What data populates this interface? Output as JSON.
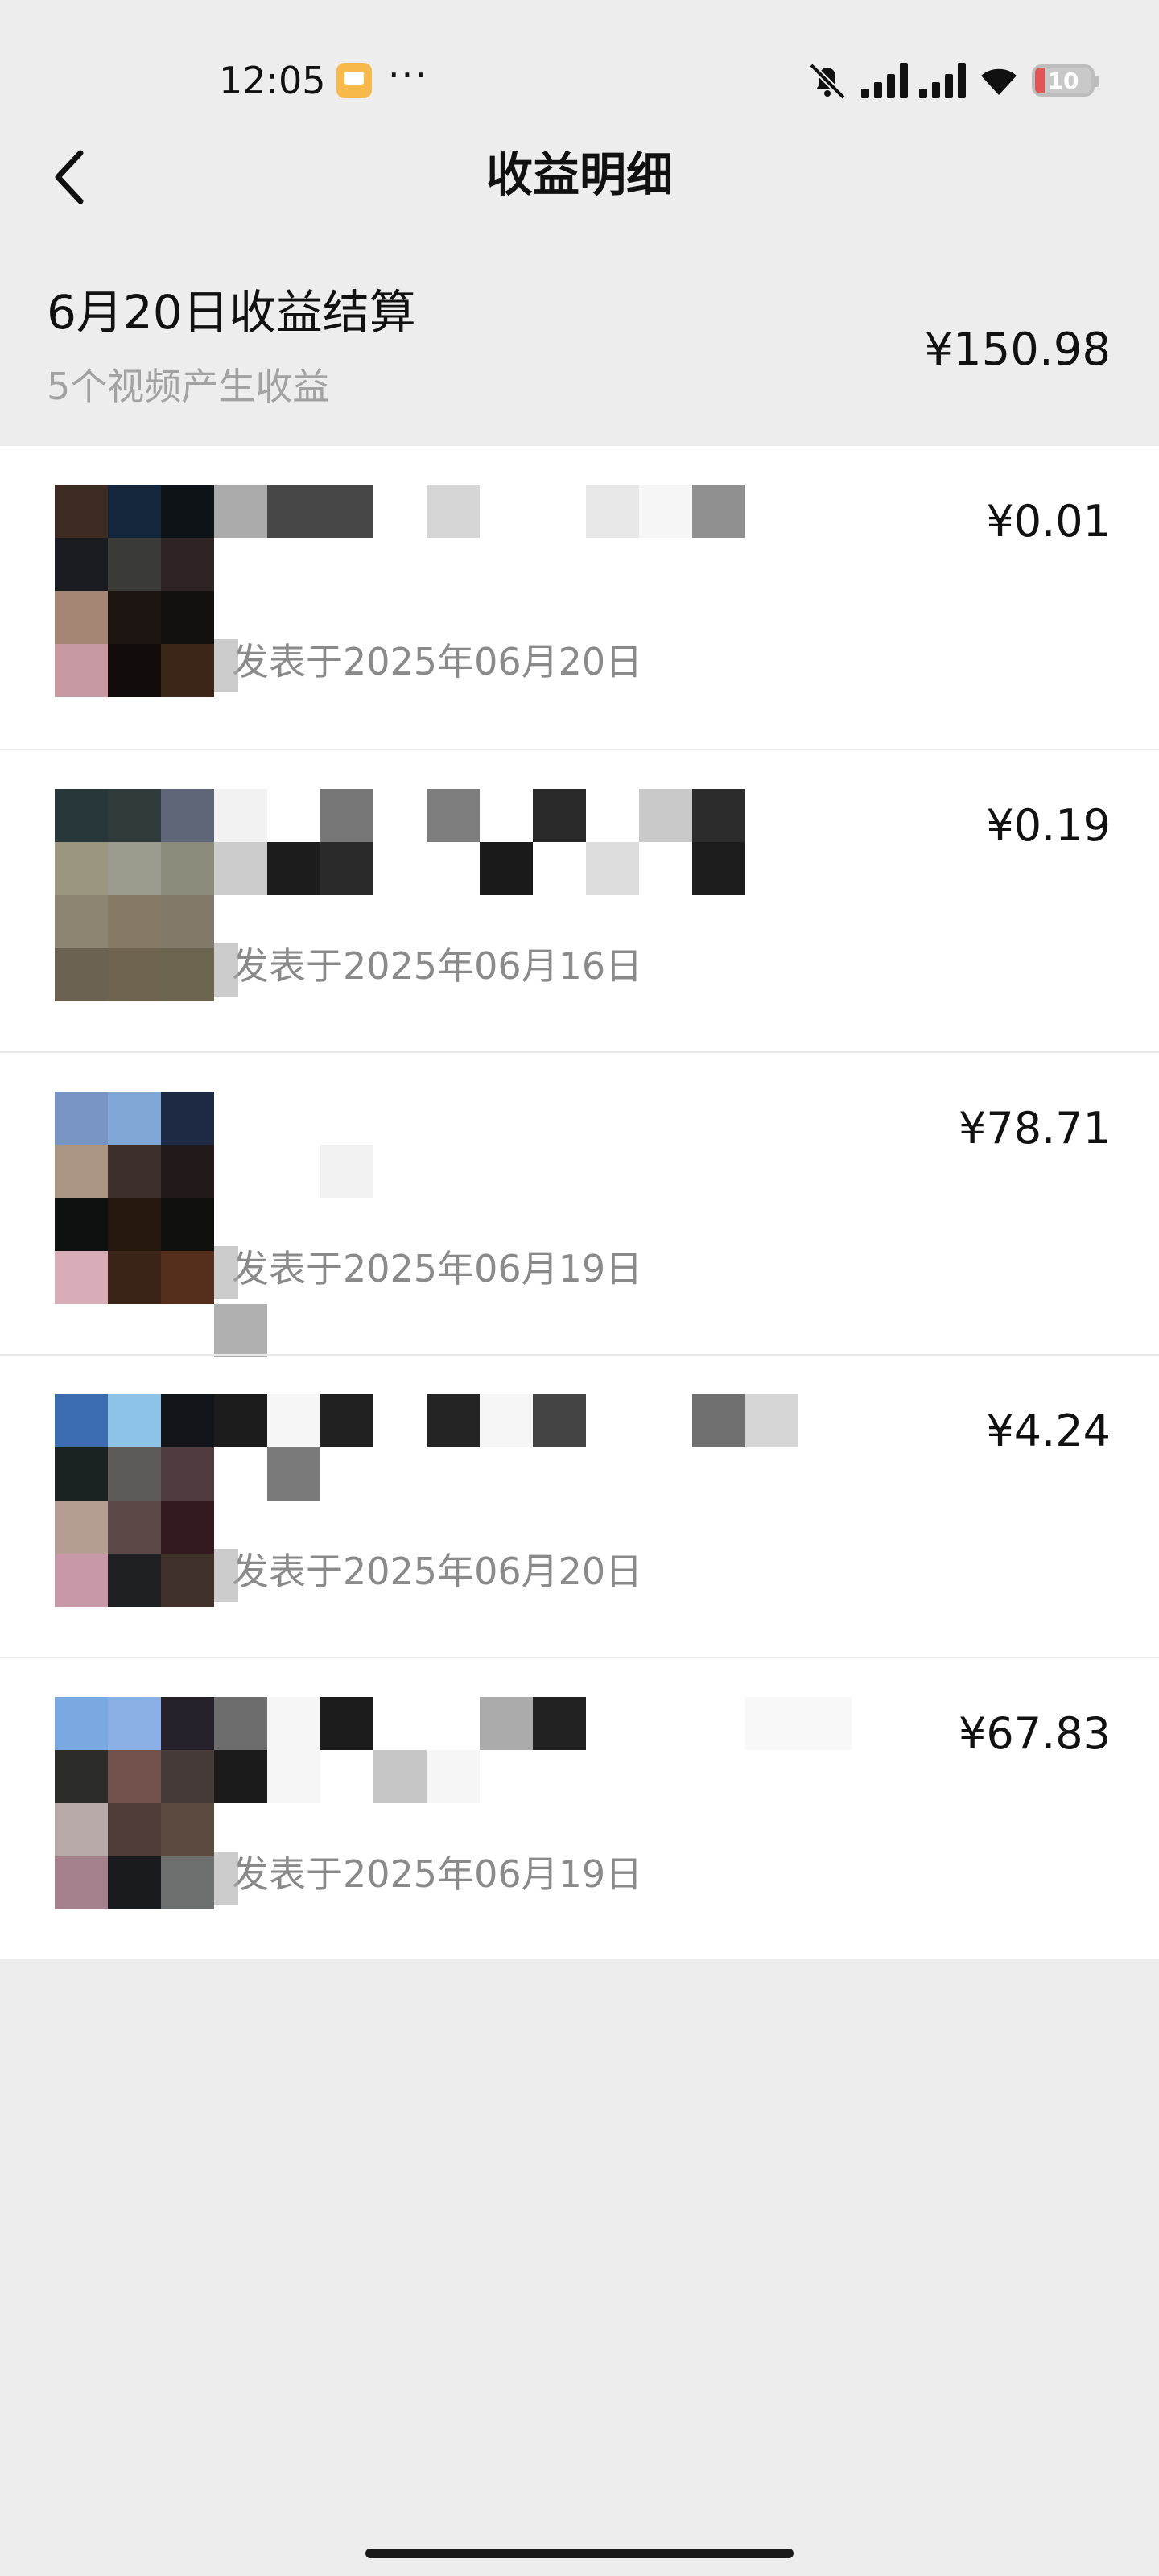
{
  "status_bar": {
    "time": "12:05",
    "dots": "···",
    "battery": "10",
    "icons": [
      "message-app-icon",
      "mute-icon",
      "signal-icon",
      "signal-icon",
      "wifi-icon",
      "battery-icon"
    ]
  },
  "header": {
    "title": "收益明细",
    "back_icon": "chevron-left-icon"
  },
  "summary": {
    "title": "6月20日收益结算",
    "subtitle": "5个视频产生收益",
    "amount": "¥150.98"
  },
  "videos": [
    {
      "title": "",
      "published": "发表于2025年06月20日",
      "amount": "¥0.01",
      "thumb_colors": [
        "#3e2c24",
        "#14263c",
        "#0e1317",
        "#1a1c22",
        "#3a3a36",
        "#2f2424",
        "#a58674",
        "#1c1512",
        "#151010",
        "#c79aa3",
        "#120d0a",
        "#3c2618"
      ],
      "title_blocks": [
        [
          "#aaaaaa",
          0,
          0
        ],
        [
          "#474747",
          66,
          0
        ],
        [
          "#474747",
          132,
          0
        ],
        [
          "#d6d6d6",
          264,
          0
        ],
        [
          "#e8e8e8",
          462,
          0
        ],
        [
          "#f6f6f6",
          528,
          0
        ],
        [
          "#909090",
          594,
          0
        ]
      ]
    },
    {
      "title": "",
      "published": "发表于2025年06月16日",
      "amount": "¥0.19",
      "thumb_colors": [
        "#28383a",
        "#2e3b3a",
        "#5f6678",
        "#9a977e",
        "#9c9c8e",
        "#8c8c7c",
        "#8b8572",
        "#867a66",
        "#83796a",
        "#6b6251",
        "#6f6450",
        "#6c6550"
      ],
      "title_blocks": [
        [
          "#f2f2f2",
          0,
          0
        ],
        [
          "#777777",
          132,
          0
        ],
        [
          "#7d7d7d",
          264,
          0
        ],
        [
          "#2a2a2a",
          396,
          0
        ],
        [
          "#c9c9c9",
          528,
          0
        ],
        [
          "#2c2c2c",
          594,
          0
        ],
        [
          "#cccccc",
          0,
          66
        ],
        [
          "#1c1c1c",
          66,
          66
        ],
        [
          "#2a2a2a",
          132,
          66
        ],
        [
          "#1a1a1a",
          330,
          66
        ],
        [
          "#dcdcdc",
          462,
          66
        ],
        [
          "#1d1d1d",
          594,
          66
        ]
      ]
    },
    {
      "title": "",
      "published": "发表于2025年06月19日",
      "amount": "¥78.71",
      "thumb_colors": [
        "#7894c4",
        "#7fa6d4",
        "#1e2a44",
        "#aa9683",
        "#3c2e2a",
        "#221a1a",
        "#0d1210",
        "#26180f",
        "#0f100c",
        "#d9adb7",
        "#3a2418",
        "#552e1c"
      ],
      "title_blocks": [
        [
          "#f2f2f2",
          132,
          66
        ],
        [
          "#b0b0b0",
          0,
          264
        ]
      ]
    },
    {
      "title": "",
      "published": "发表于2025年06月20日",
      "amount": "¥4.24",
      "thumb_colors": [
        "#3b6db0",
        "#8cc3e6",
        "#111418",
        "#1b2222",
        "#5e5a57",
        "#4e3b3d",
        "#b59d94",
        "#5c4846",
        "#331a1e",
        "#c898a8",
        "#1e2022",
        "#40322a"
      ],
      "title_blocks": [
        [
          "#1c1c1c",
          0,
          0
        ],
        [
          "#f6f6f6",
          66,
          0
        ],
        [
          "#212121",
          132,
          0
        ],
        [
          "#242424",
          264,
          0
        ],
        [
          "#f6f6f6",
          330,
          0
        ],
        [
          "#444444",
          396,
          0
        ],
        [
          "#707070",
          594,
          0
        ],
        [
          "#d6d6d6",
          660,
          0
        ],
        [
          "#7a7a7a",
          66,
          66
        ]
      ]
    },
    {
      "title": "",
      "published": "发表于2025年06月19日",
      "amount": "¥67.83",
      "thumb_colors": [
        "#7aa8e0",
        "#8ab0e6",
        "#26202a",
        "#2c2c28",
        "#72504c",
        "#463a38",
        "#b8aaa8",
        "#4e3c38",
        "#5a4a40",
        "#a4808c",
        "#191b1e",
        "#6e7070"
      ],
      "title_blocks": [
        [
          "#6d6d6d",
          0,
          0
        ],
        [
          "#f6f6f6",
          66,
          0
        ],
        [
          "#1c1c1c",
          132,
          0
        ],
        [
          "#ababab",
          330,
          0
        ],
        [
          "#222222",
          396,
          0
        ],
        [
          "#f8f8f8",
          660,
          0
        ],
        [
          "#f8f8f8",
          726,
          0
        ],
        [
          "#1b1b1b",
          0,
          66
        ],
        [
          "#f6f6f6",
          66,
          66
        ],
        [
          "#c6c6c6",
          198,
          66
        ],
        [
          "#f6f6f6",
          264,
          66
        ]
      ]
    }
  ]
}
